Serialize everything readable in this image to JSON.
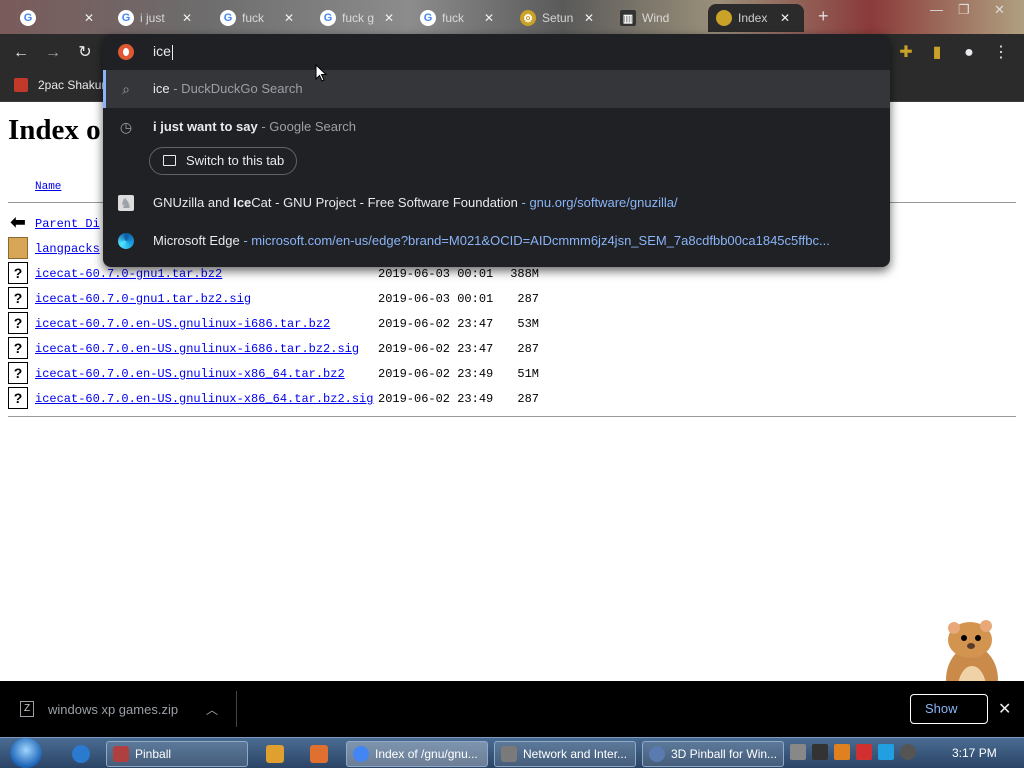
{
  "tabs": [
    {
      "label": "",
      "favicon": "G",
      "active": false
    },
    {
      "label": "i just",
      "favicon": "G",
      "active": false
    },
    {
      "label": "fuck",
      "favicon": "G",
      "active": false
    },
    {
      "label": "fuck g",
      "favicon": "G",
      "active": false
    },
    {
      "label": "fuck",
      "favicon": "G",
      "active": false
    },
    {
      "label": "Setun",
      "favicon": "gear",
      "active": false
    },
    {
      "label": "Wind",
      "favicon": "archive",
      "active": false
    },
    {
      "label": "Index",
      "favicon": "gnu",
      "active": true
    }
  ],
  "omnibox": {
    "input_value": "ice",
    "suggestions": [
      {
        "bold": "ice",
        "rest": " - DuckDuckGo Search",
        "icon": "search-icon",
        "selected": true
      },
      {
        "bold": "i just want to say",
        "rest": " - Google Search",
        "icon": "history-icon",
        "selected": false
      }
    ],
    "switch_tab_label": "Switch to this tab",
    "gnu_suggestion": {
      "pre": "GNUzilla and ",
      "bold": "Ice",
      "post": "Cat - GNU Project - Free Software Foundation",
      "url": " - gnu.org/software/gnuzilla/"
    },
    "edge_suggestion": {
      "title": "Microsoft Edge",
      "url": " - microsoft.com/en-us/edge?brand=M021&OCID=AIDcmmm6jz4jsn_SEM_7a8cdfbb00ca1845c5ffbc..."
    }
  },
  "bookmarks": [
    {
      "label": "2pac Shakur"
    }
  ],
  "page": {
    "title": "Index o",
    "col_name": "Name",
    "rows": [
      {
        "name": "Parent Di",
        "date": "",
        "size": "",
        "icon": "back"
      },
      {
        "name": "langpacks",
        "date": "",
        "size": "",
        "icon": "folder"
      },
      {
        "name": "icecat-60.7.0-gnu1.tar.bz2",
        "date": "2019-06-03 00:01",
        "size": "388M",
        "icon": "unknown"
      },
      {
        "name": "icecat-60.7.0-gnu1.tar.bz2.sig",
        "date": "2019-06-03 00:01",
        "size": "287",
        "icon": "unknown"
      },
      {
        "name": "icecat-60.7.0.en-US.gnulinux-i686.tar.bz2",
        "date": "2019-06-02 23:47",
        "size": "53M",
        "icon": "unknown"
      },
      {
        "name": "icecat-60.7.0.en-US.gnulinux-i686.tar.bz2.sig",
        "date": "2019-06-02 23:47",
        "size": "287",
        "icon": "unknown"
      },
      {
        "name": "icecat-60.7.0.en-US.gnulinux-x86_64.tar.bz2",
        "date": "2019-06-02 23:49",
        "size": "51M",
        "icon": "unknown"
      },
      {
        "name": "icecat-60.7.0.en-US.gnulinux-x86_64.tar.bz2.sig",
        "date": "2019-06-02 23:49",
        "size": "287",
        "icon": "unknown"
      }
    ]
  },
  "download_bar": {
    "filename": "windows xp games.zip",
    "show_all_label": "Show"
  },
  "taskbar": {
    "items": [
      {
        "label": "Pinball",
        "color": "#b04040"
      },
      {
        "label": "Index of /gnu/gnu...",
        "color": "#4285f4",
        "active": true
      },
      {
        "label": "Network and Inter...",
        "color": "#7a7a7a"
      },
      {
        "label": "3D Pinball for Win...",
        "color": "#5a7ab0"
      }
    ],
    "clock": "3:17 PM"
  }
}
